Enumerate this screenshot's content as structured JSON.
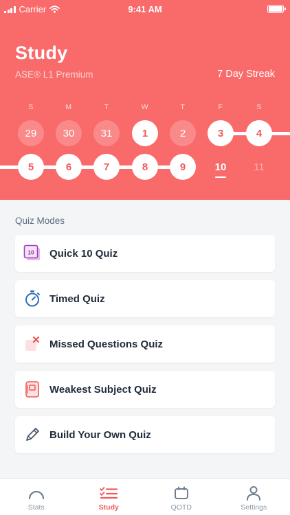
{
  "status_bar": {
    "carrier": "Carrier",
    "time": "9:41 AM"
  },
  "header": {
    "title": "Study",
    "subtitle": "ASE® L1 Premium",
    "streak": "7 Day Streak"
  },
  "calendar": {
    "weekdays": [
      "S",
      "M",
      "T",
      "W",
      "T",
      "F",
      "S"
    ],
    "week1": [
      {
        "day": "29",
        "state": "faded"
      },
      {
        "day": "30",
        "state": "faded"
      },
      {
        "day": "31",
        "state": "faded"
      },
      {
        "day": "1",
        "state": "done"
      },
      {
        "day": "2",
        "state": "faded"
      },
      {
        "day": "3",
        "state": "done"
      },
      {
        "day": "4",
        "state": "done"
      }
    ],
    "week2": [
      {
        "day": "5",
        "state": "done"
      },
      {
        "day": "6",
        "state": "done"
      },
      {
        "day": "7",
        "state": "done"
      },
      {
        "day": "8",
        "state": "done"
      },
      {
        "day": "9",
        "state": "done"
      },
      {
        "day": "10",
        "state": "today"
      },
      {
        "day": "11",
        "state": "future"
      }
    ]
  },
  "quiz_modes": {
    "heading": "Quiz Modes",
    "items": [
      {
        "label": "Quick 10 Quiz",
        "icon": "quick-10-icon",
        "badge": "10"
      },
      {
        "label": "Timed Quiz",
        "icon": "stopwatch-icon"
      },
      {
        "label": "Missed Questions Quiz",
        "icon": "missed-x-icon"
      },
      {
        "label": "Weakest Subject Quiz",
        "icon": "notebook-icon"
      },
      {
        "label": "Build Your Own Quiz",
        "icon": "pencil-icon"
      }
    ]
  },
  "tabs": [
    {
      "label": "Stats",
      "icon": "gauge-icon",
      "active": false
    },
    {
      "label": "Study",
      "icon": "checklist-icon",
      "active": true
    },
    {
      "label": "QOTD",
      "icon": "calendar-icon",
      "active": false
    },
    {
      "label": "Settings",
      "icon": "person-icon",
      "active": false
    }
  ],
  "colors": {
    "accent": "#f96a6a",
    "accent_text": "#f25b5b",
    "background": "#f4f5f7",
    "text": "#1f2b3a"
  }
}
